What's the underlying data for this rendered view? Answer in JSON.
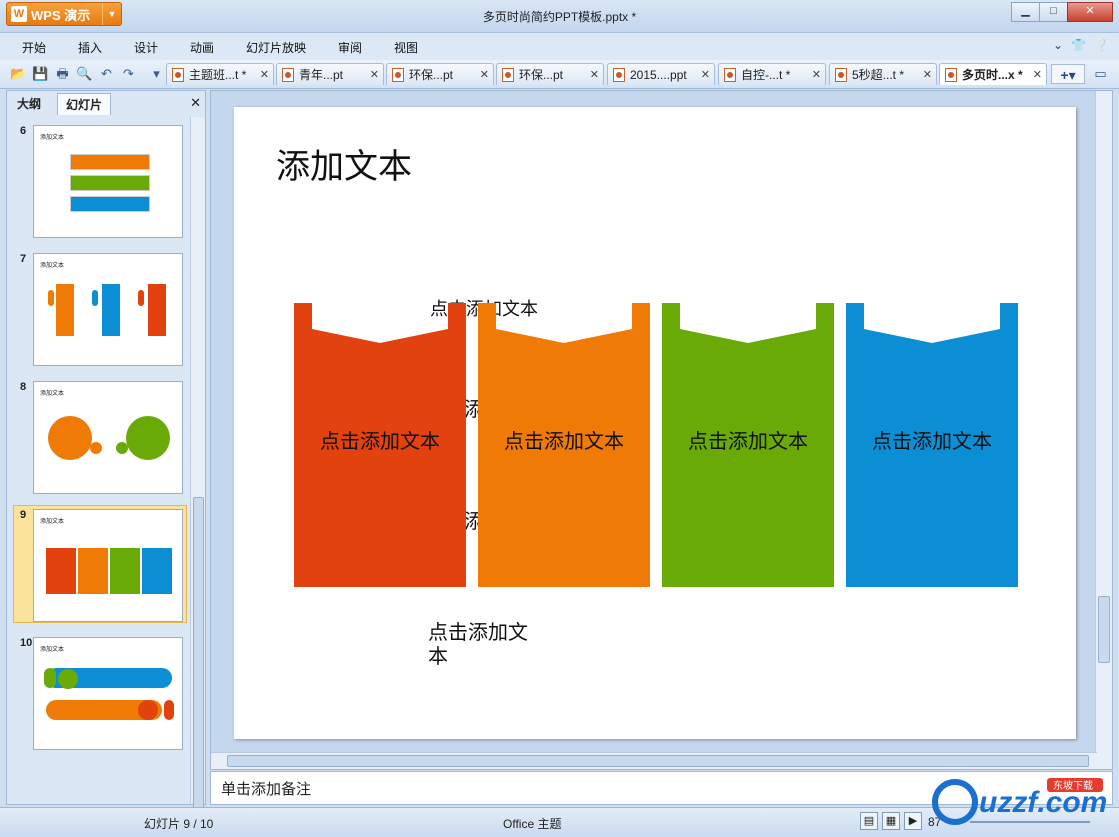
{
  "app": {
    "name": "WPS 演示",
    "window_title": "多页时尚简约PPT模板.pptx *"
  },
  "menu": [
    "开始",
    "插入",
    "设计",
    "动画",
    "幻灯片放映",
    "审阅",
    "视图"
  ],
  "tabs": [
    {
      "label": "主题班...t *"
    },
    {
      "label": "青年...pt"
    },
    {
      "label": "环保...pt"
    },
    {
      "label": "环保...pt"
    },
    {
      "label": "2015....ppt"
    },
    {
      "label": "自控-...t *"
    },
    {
      "label": "5秒超...t *"
    },
    {
      "label": "多页时...x *",
      "active": true
    }
  ],
  "left_pane": {
    "tab_outline": "大纲",
    "tab_slides": "幻灯片",
    "close": "✕",
    "thumbnails": [
      {
        "num": "6",
        "title": "添加文本"
      },
      {
        "num": "7",
        "title": "添加文本"
      },
      {
        "num": "8",
        "title": "添加文本"
      },
      {
        "num": "9",
        "title": "添加文本",
        "selected": true
      },
      {
        "num": "10",
        "title": "添加文本"
      }
    ]
  },
  "slide": {
    "title": "添加文本",
    "cards": [
      {
        "label": "点击添加文本",
        "color": "#e2420e"
      },
      {
        "label": "点击添加文本",
        "color": "#ef7a06"
      },
      {
        "label": "点击添加文本",
        "color": "#6aaa07"
      },
      {
        "label": "点击添加文本",
        "color": "#0b8ed3"
      }
    ],
    "bottom_text": "点击添加文本"
  },
  "notes": {
    "placeholder": "单击添加备注"
  },
  "status": {
    "slide_count": "幻灯片 9 / 10",
    "theme": "Office 主题",
    "zoom": "87"
  }
}
